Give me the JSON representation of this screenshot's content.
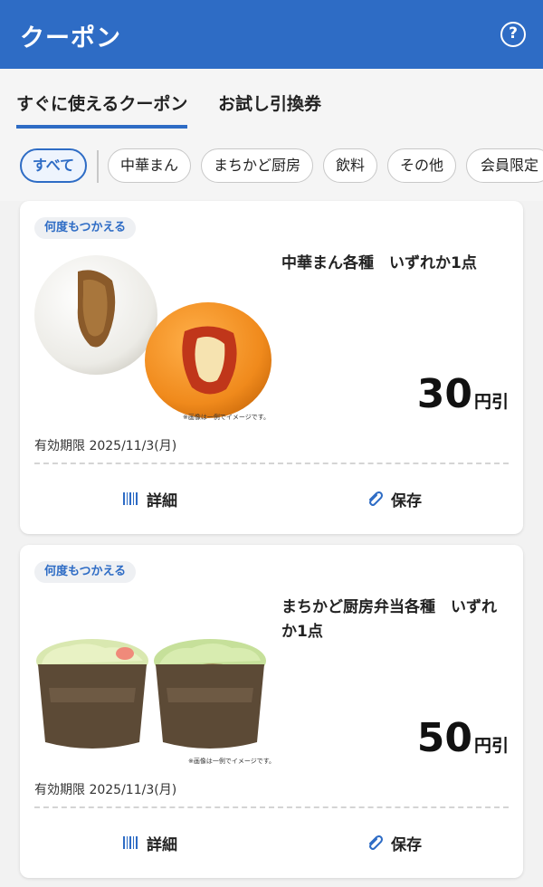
{
  "header": {
    "title": "クーポン",
    "help_icon": "question-circle-icon"
  },
  "tabs": [
    {
      "label": "すぐに使えるクーポン",
      "active": true
    },
    {
      "label": "お試し引換券",
      "active": false
    }
  ],
  "filters": [
    "すべて",
    "中華まん",
    "まちかど厨房",
    "飲料",
    "その他",
    "会員限定"
  ],
  "colors": {
    "primary": "#2e6cc5",
    "background": "#f2f2f2"
  },
  "coupons": [
    {
      "badge": "何度もつかえる",
      "product": "中華まん各種　いずれか1点",
      "amount": "30",
      "unit": "円引",
      "expiry": "有効期限  2025/11/3(月)",
      "disclaimer": "※画像は一例でイメージです。",
      "detail_label": "詳細",
      "detail_icon": "barcode-icon",
      "save_label": "保存",
      "save_icon": "paperclip-icon"
    },
    {
      "badge": "何度もつかえる",
      "product": "まちかど厨房弁当各種　いずれか1点",
      "amount": "50",
      "unit": "円引",
      "expiry": "有効期限  2025/11/3(月)",
      "disclaimer": "※画像は一例でイメージです。",
      "detail_label": "詳細",
      "detail_icon": "barcode-icon",
      "save_label": "保存",
      "save_icon": "paperclip-icon"
    }
  ]
}
